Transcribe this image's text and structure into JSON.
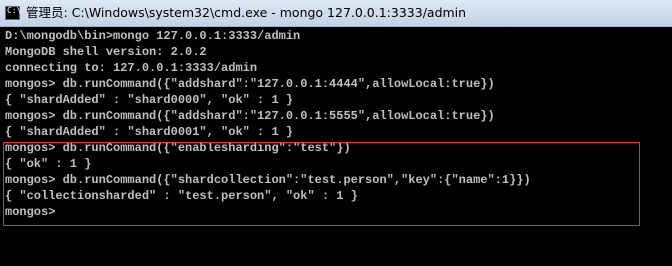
{
  "window": {
    "title": "管理员: C:\\Windows\\system32\\cmd.exe - mongo  127.0.0.1:3333/admin",
    "icon_glyph": "C:\\",
    "icon": "cmd-icon"
  },
  "console": {
    "lines": [
      "D:\\mongodb\\bin>mongo 127.0.0.1:3333/admin",
      "MongoDB shell version: 2.0.2",
      "connecting to: 127.0.0.1:3333/admin",
      "mongos> db.runCommand({\"addshard\":\"127.0.0.1:4444\",allowLocal:true})",
      "{ \"shardAdded\" : \"shard0000\", \"ok\" : 1 }",
      "mongos> db.runCommand({\"addshard\":\"127.0.0.1:5555\",allowLocal:true})",
      "{ \"shardAdded\" : \"shard0001\", \"ok\" : 1 }",
      "mongos> db.runCommand({\"enablesharding\":\"test\"})",
      "{ \"ok\" : 1 }",
      "mongos> db.runCommand({\"shardcollection\":\"test.person\",\"key\":{\"name\":1}})",
      "{ \"collectionsharded\" : \"test.person\", \"ok\" : 1 }",
      "mongos>"
    ]
  },
  "colors": {
    "console_text": "#c0c0c0",
    "console_background": "#000000",
    "highlight_border": "#e8322e"
  }
}
